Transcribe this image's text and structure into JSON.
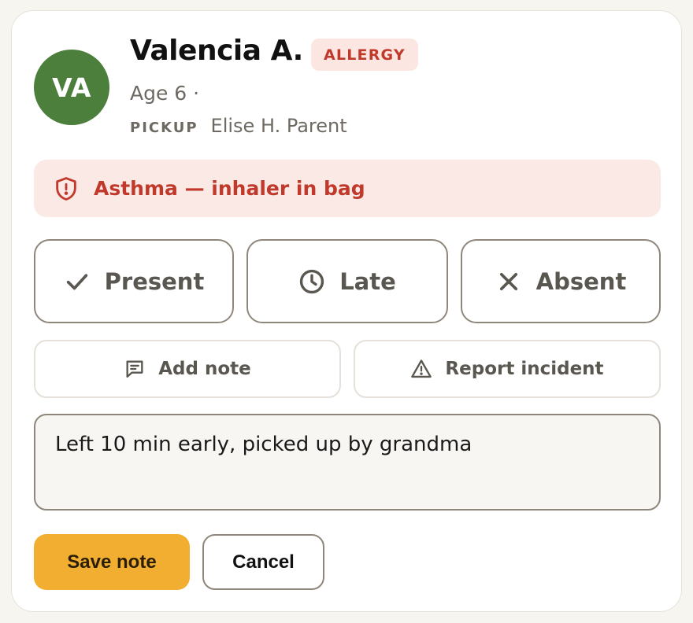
{
  "student": {
    "initials": "VA",
    "name": "Valencia A.",
    "badge": "ALLERGY",
    "age": "Age 6 ·",
    "pickup_label": "PICKUP",
    "pickup_name": "Elise H. Parent",
    "avatar_color": "#4b7f3b"
  },
  "alert": {
    "icon": "shield-alert-icon",
    "text": "Asthma — inhaler in bag",
    "color": "#c0392b"
  },
  "status_buttons": [
    {
      "label": "Present",
      "icon": "check-icon"
    },
    {
      "label": "Late",
      "icon": "clock-icon"
    },
    {
      "label": "Absent",
      "icon": "x-icon"
    }
  ],
  "actions": [
    {
      "label": "Add note",
      "icon": "message-icon"
    },
    {
      "label": "Report incident",
      "icon": "warning-icon"
    }
  ],
  "note": {
    "value": "Left 10 min early, picked up by grandma"
  },
  "buttons": {
    "save": "Save note",
    "cancel": "Cancel"
  },
  "colors": {
    "accent": "#f2ae30",
    "danger": "#c0392b",
    "danger_bg": "#fbe9e6"
  }
}
